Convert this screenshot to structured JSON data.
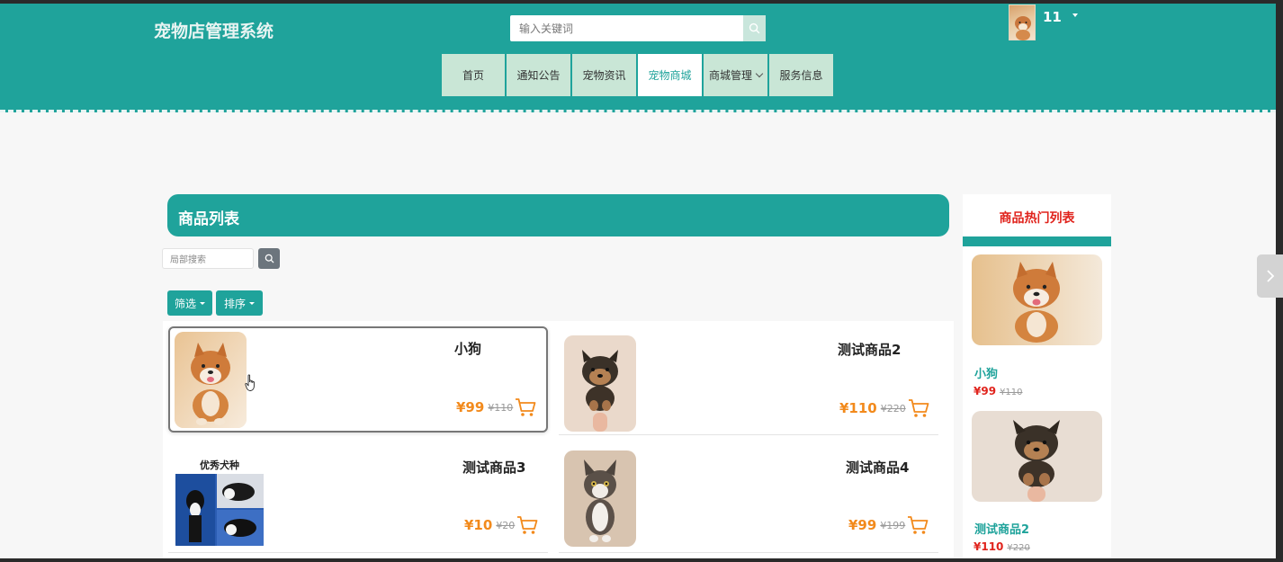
{
  "header": {
    "site_title": "宠物店管理系统",
    "search_placeholder": "输入关键词",
    "user_name": "11",
    "nav": [
      {
        "label": "首页",
        "active": false
      },
      {
        "label": "通知公告",
        "active": false
      },
      {
        "label": "宠物资讯",
        "active": false
      },
      {
        "label": "宠物商城",
        "active": true
      },
      {
        "label": "商城管理",
        "active": false,
        "dropdown": true
      },
      {
        "label": "服务信息",
        "active": false
      }
    ]
  },
  "main": {
    "list_title": "商品列表",
    "local_search_placeholder": "局部搜索",
    "filter_label": "筛选",
    "sort_label": "排序",
    "products": [
      {
        "name": "小狗",
        "price": "¥99",
        "old_price": "¥110",
        "image": "shiba-puppy"
      },
      {
        "name": "测试商品2",
        "price": "¥110",
        "old_price": "¥220",
        "image": "yorkie-puppy"
      },
      {
        "name": "测试商品3",
        "price": "¥10",
        "old_price": "¥20",
        "image": "border-collie-collage",
        "image_caption": "优秀犬种"
      },
      {
        "name": "测试商品4",
        "price": "¥99",
        "old_price": "¥199",
        "image": "kitten"
      }
    ]
  },
  "hot": {
    "title": "商品热门列表",
    "items": [
      {
        "name": "小狗",
        "price": "¥99",
        "old_price": "¥110",
        "image": "shiba-puppy"
      },
      {
        "name": "测试商品2",
        "price": "¥110",
        "old_price": "¥220",
        "image": "yorkie-puppy"
      }
    ]
  },
  "colors": {
    "primary": "#1fa39b",
    "nav_bg": "#c9e6d6",
    "price": "#f28a1c",
    "hot_price": "#e0231c"
  }
}
